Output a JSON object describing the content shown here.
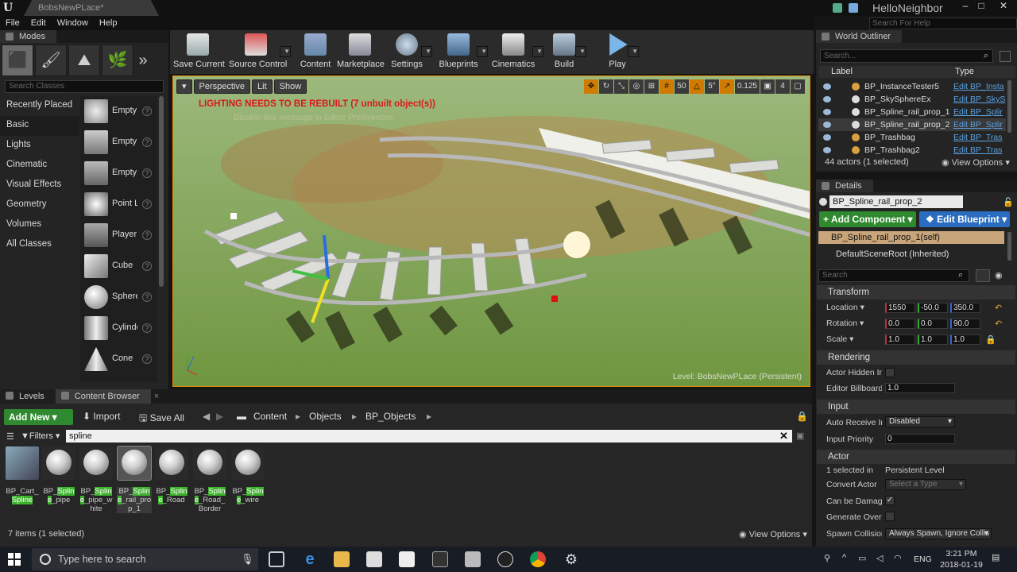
{
  "window": {
    "doc_tab": "BobsNewPLace*",
    "project": "HelloNeighbor",
    "help_search": "Search For Help",
    "menu": [
      "File",
      "Edit",
      "Window",
      "Help"
    ]
  },
  "modes": {
    "tab": "Modes",
    "search_placeholder": "Search Classes",
    "categories": [
      "Recently Placed",
      "Basic",
      "Lights",
      "Cinematic",
      "Visual Effects",
      "Geometry",
      "Volumes",
      "All Classes"
    ],
    "selected_category": "Basic",
    "items": [
      "Empty",
      "Empty",
      "Empty",
      "Point L",
      "Player",
      "Cube",
      "Sphere",
      "Cylinde",
      "Cone"
    ]
  },
  "toolbar": {
    "buttons": [
      "Save Current",
      "Source Control",
      "Content",
      "Marketplace",
      "Settings",
      "Blueprints",
      "Cinematics",
      "Build",
      "Play"
    ]
  },
  "viewport": {
    "perspective": "Perspective",
    "lit": "Lit",
    "show": "Show",
    "grid_snap": "50",
    "rot_snap": "5°",
    "scale_snap": "0.125",
    "cam_speed": "4",
    "lighting_warning": "LIGHTING NEEDS TO BE REBUILT (7 unbuilt object(s))",
    "lighting_sub": "Disable this message in Editor Preferences",
    "level_label": "Level:  BobsNewPLace (Persistent)"
  },
  "outliner": {
    "tab": "World Outliner",
    "search_placeholder": "Search...",
    "col_label": "Label",
    "col_type": "Type",
    "rows": [
      {
        "name": "BP_InstanceTester5",
        "type": "Edit BP_Insta"
      },
      {
        "name": "BP_SkySphereEx",
        "type": "Edit BP_SkyS"
      },
      {
        "name": "BP_Spline_rail_prop_1",
        "type": "Edit BP_Splir"
      },
      {
        "name": "BP_Spline_rail_prop_2",
        "type": "Edit BP_Splir"
      },
      {
        "name": "BP_Trashbag",
        "type": "Edit BP_Tras"
      },
      {
        "name": "BP_Trashbag2",
        "type": "Edit BP_Tras"
      }
    ],
    "selected_row": 3,
    "count": "44 actors (1 selected)",
    "view_options": "View Options"
  },
  "details": {
    "tab": "Details",
    "name": "BP_Spline_rail_prop_2",
    "add_component": "+ Add Component",
    "edit_blueprint": "Edit Blueprint",
    "comp_self": "BP_Spline_rail_prop_1(self)",
    "comp_root": "DefaultSceneRoot (Inherited)",
    "search_placeholder": "Search",
    "transform": {
      "title": "Transform",
      "location_label": "Location",
      "rotation_label": "Rotation",
      "scale_label": "Scale",
      "location": [
        "1550",
        "-50.0",
        "350.0"
      ],
      "rotation": [
        "0.0",
        "0.0",
        "90.0"
      ],
      "scale": [
        "1.0",
        "1.0",
        "1.0"
      ]
    },
    "rendering": {
      "title": "Rendering",
      "actor_hidden": "Actor Hidden In G",
      "billboard": "Editor Billboard S",
      "billboard_value": "1.0"
    },
    "input": {
      "title": "Input",
      "auto_receive": "Auto Receive Inp",
      "auto_receive_value": "Disabled",
      "priority": "Input Priority",
      "priority_value": "0"
    },
    "actor": {
      "title": "Actor",
      "selected_in": "1 selected in",
      "selected_in_value": "Persistent Level",
      "convert": "Convert Actor",
      "convert_value": "Select a Type",
      "can_damage": "Can be Damaged",
      "gen_overlap": "Generate Overla",
      "spawn": "Spawn Collision",
      "spawn_value": "Always Spawn, Ignore Collis"
    }
  },
  "content_browser": {
    "tab_levels": "Levels",
    "tab_cb": "Content Browser",
    "add_new": "Add New",
    "import": "Import",
    "save_all": "Save All",
    "path": [
      "Content",
      "Objects",
      "BP_Objects"
    ],
    "filters": "Filters",
    "search": "spline",
    "assets": [
      {
        "pre": "BP_Cart_",
        "hl": "Spline",
        "post": ""
      },
      {
        "pre": "BP_",
        "hl": "Spline",
        "post": "_pipe"
      },
      {
        "pre": "BP_",
        "hl": "Spline",
        "post": "_pipe_white"
      },
      {
        "pre": "BP_",
        "hl": "Spline",
        "post": "_rail_prop_1"
      },
      {
        "pre": "BP_",
        "hl": "Spline",
        "post": "_Road"
      },
      {
        "pre": "BP_",
        "hl": "Spline",
        "post": "_Road_Border"
      },
      {
        "pre": "BP_",
        "hl": "Spline",
        "post": "_wire"
      }
    ],
    "count": "7 items (1 selected)",
    "view_options": "View Options"
  },
  "taskbar": {
    "search": "Type here to search",
    "lang": "ENG",
    "time": "3:21 PM",
    "date": "2018-01-19"
  }
}
